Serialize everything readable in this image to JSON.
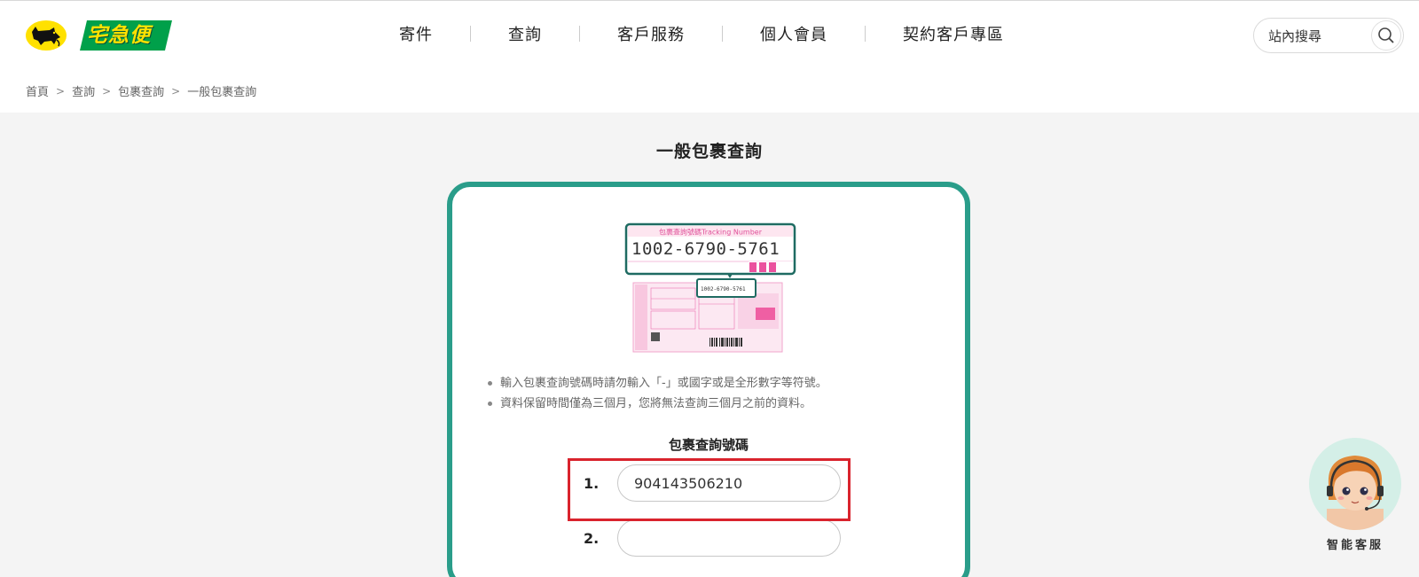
{
  "brand": {
    "logo_text": "宅急便",
    "colors": {
      "accent_green": "#2a9d8a",
      "logo_green": "#00a04a",
      "logo_yellow": "#ffe100",
      "highlight_red": "#d9232d"
    }
  },
  "nav": {
    "items": [
      {
        "label": "寄件"
      },
      {
        "label": "查詢"
      },
      {
        "label": "客戶服務"
      },
      {
        "label": "個人會員"
      },
      {
        "label": "契約客戶專區"
      }
    ]
  },
  "search": {
    "placeholder": "站內搜尋",
    "icon": "search-icon"
  },
  "breadcrumb": {
    "items": [
      "首頁",
      "查詢",
      "包裹查詢",
      "一般包裹查詢"
    ]
  },
  "page": {
    "title": "一般包裹查詢",
    "receipt": {
      "tag_title": "包裹查詢號碼Tracking Number",
      "tracking_example": "1002-6790-5761",
      "small_example": "1002-6790-5761"
    },
    "notes": [
      "輸入包裹查詢號碼時請勿輸入「-」或國字或是全形數字等符號。",
      "資料保留時間僅為三個月，您將無法查詢三個月之前的資料。"
    ],
    "field_label": "包裹查詢號碼",
    "inputs": [
      {
        "num": "1.",
        "value": "904143506210"
      },
      {
        "num": "2.",
        "value": ""
      }
    ]
  },
  "chatbot": {
    "label": "智能客服"
  }
}
